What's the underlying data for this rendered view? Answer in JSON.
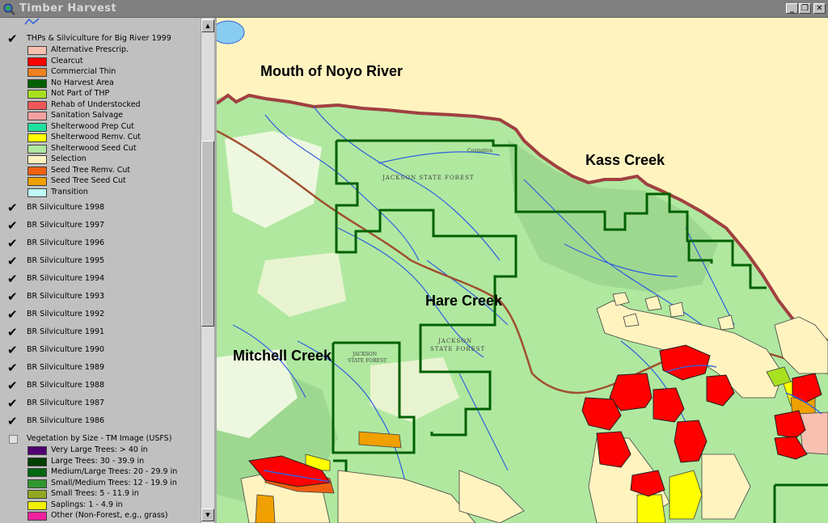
{
  "window": {
    "title": "Timber Harvest",
    "min_glyph": "_",
    "restore_glyph": "❐",
    "close_glyph": "✕"
  },
  "legend": {
    "thp_layer": {
      "label": "THPs & Silviculture for Big River 1999",
      "checked": true,
      "classes": [
        {
          "label": "Alternative Prescrip.",
          "color": "#f8c0b0"
        },
        {
          "label": "Clearcut",
          "color": "#ff0000"
        },
        {
          "label": "Commercial Thin",
          "color": "#f08020"
        },
        {
          "label": "No Harvest Area",
          "color": "#006000"
        },
        {
          "label": "Not Part of THP",
          "color": "#a8e020"
        },
        {
          "label": "Rehab of Understocked",
          "color": "#f05858"
        },
        {
          "label": "Sanitation Salvage",
          "color": "#f4a0a0"
        },
        {
          "label": "Shelterwood Prep Cut",
          "color": "#20e0a0"
        },
        {
          "label": "Shelterwood Remv. Cut",
          "color": "#ffff00"
        },
        {
          "label": "Shelterwood Seed Cut",
          "color": "#b0e8a0"
        },
        {
          "label": "Selection",
          "color": "#fff4c0"
        },
        {
          "label": "Seed Tree Remv. Cut",
          "color": "#f06010"
        },
        {
          "label": "Seed Tree Seed Cut",
          "color": "#f0a000"
        },
        {
          "label": "Transition",
          "color": "#c0fcf8"
        }
      ]
    },
    "year_layers": [
      {
        "label": "BR Silviculture 1998",
        "checked": true
      },
      {
        "label": "BR Silviculture 1997",
        "checked": true
      },
      {
        "label": "BR Silviculture 1996",
        "checked": true
      },
      {
        "label": "BR Silviculture 1995",
        "checked": true
      },
      {
        "label": "BR Silviculture 1994",
        "checked": true
      },
      {
        "label": "BR Silviculture 1993",
        "checked": true
      },
      {
        "label": "BR Silviculture 1992",
        "checked": true
      },
      {
        "label": "BR Silviculture 1991",
        "checked": true
      },
      {
        "label": "BR Silviculture 1990",
        "checked": true
      },
      {
        "label": "BR Silviculture 1989",
        "checked": true
      },
      {
        "label": "BR Silviculture 1988",
        "checked": true
      },
      {
        "label": "BR Silviculture 1987",
        "checked": true
      },
      {
        "label": "BR Silviculture 1986",
        "checked": true
      }
    ],
    "veg_layer": {
      "label": "Vegetation by Size - TM Image (USFS)",
      "checked": false,
      "classes": [
        {
          "label": "Very Large Trees: > 40  in",
          "color": "#500070"
        },
        {
          "label": "Large Trees: 30 - 39.9 in",
          "color": "#004000"
        },
        {
          "label": "Medium/Large Trees: 20 - 29.9 in",
          "color": "#006810"
        },
        {
          "label": "Small/Medium Trees: 12 - 19.9 in",
          "color": "#309830"
        },
        {
          "label": "Small Trees: 5 - 11.9 in",
          "color": "#90a820"
        },
        {
          "label": "Saplings: 1 - 4.9 in",
          "color": "#f0f000"
        },
        {
          "label": "Other (Non-Forest, e.g., grass)",
          "color": "#f020a0"
        }
      ]
    }
  },
  "map": {
    "labels": {
      "noyo": "Mouth of Noyo River",
      "kass": "Kass Creek",
      "hare": "Hare Creek",
      "mitchell": "Mitchell Creek",
      "jsf1": "JACKSON STATE FOREST",
      "jsf2": "JACKSON",
      "jsf3": "STATE FOREST",
      "jsf4": "JACKSON",
      "jsf5": "STATE FOREST",
      "covington": "Covington"
    },
    "colors": {
      "ocean": "#fff4c0",
      "forest": "#b0e8a0",
      "forest_dark": "#9ed890",
      "stream": "#3060e0",
      "road": "#a05030",
      "boundary": "#a04040",
      "state_forest": "#006000",
      "clearcut": "#ff0000",
      "selection": "#fff4c0",
      "shelterwood_remv": "#ffff00",
      "not_thp": "#a8e020",
      "seed_tree": "#f0a000",
      "seed_remv": "#f06010",
      "alt": "#f8c0b0",
      "water_blue": "#88ccf0"
    }
  }
}
